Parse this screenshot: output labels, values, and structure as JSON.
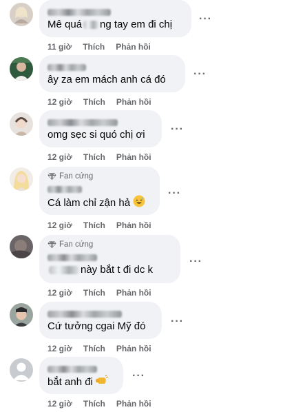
{
  "comments": [
    {
      "text": "Mê quá     ng tay em đi chị",
      "text_parts": [
        "Mê quá",
        "ng tay em đi chị"
      ],
      "time": "11 giờ",
      "like_label": "Thích",
      "reply_label": "Phản hồi",
      "avatar_icon": "profile-photo-icon"
    },
    {
      "text": "ây za em mách anh cá đó",
      "time": "12 giờ",
      "like_label": "Thích",
      "reply_label": "Phản hồi",
      "avatar_icon": "profile-photo-icon"
    },
    {
      "text": "omg sẹc si quó chị ơi",
      "time": "12 giờ",
      "like_label": "Thích",
      "reply_label": "Phản hồi",
      "avatar_icon": "profile-photo-icon"
    },
    {
      "badge": "Fan cứng",
      "text": "Cá làm chỉ zận hả",
      "emoji": "sweat-smile-emoji",
      "time": "12 giờ",
      "like_label": "Thích",
      "reply_label": "Phản hồi",
      "avatar_icon": "profile-photo-icon"
    },
    {
      "badge": "Fan cứng",
      "text": "này bắt t đi dc k",
      "time": "12 giờ",
      "like_label": "Thích",
      "reply_label": "Phản hồi",
      "avatar_icon": "profile-photo-icon"
    },
    {
      "text": "Cứ tưởng cgai Mỹ đó",
      "time": "12 giờ",
      "like_label": "Thích",
      "reply_label": "Phản hồi",
      "avatar_icon": "profile-photo-icon"
    },
    {
      "text": "bắt anh đi",
      "emoji": "fist-bump-emoji",
      "time": "12 giờ",
      "like_label": "Thích",
      "reply_label": "Phản hồi",
      "avatar_icon": "default-avatar-icon"
    }
  ],
  "more_icon": "more-options-icon",
  "colors": {
    "bubble": "#f0f2f5",
    "text": "#050505",
    "meta": "#65676b",
    "badge_diamond": "#65676b"
  }
}
